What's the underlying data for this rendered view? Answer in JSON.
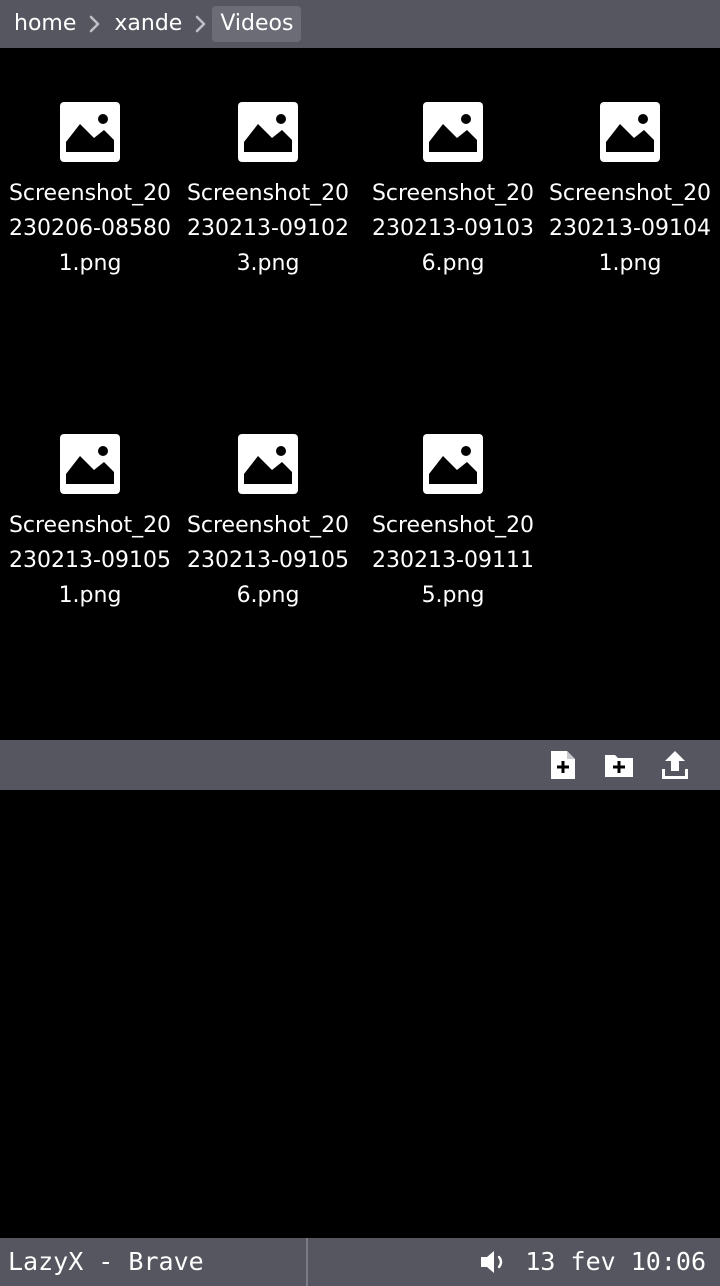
{
  "breadcrumb": {
    "items": [
      "home",
      "xande",
      "Videos"
    ]
  },
  "files": [
    {
      "name": "Screenshot_20230206-085801.png",
      "icon": "image-file-icon"
    },
    {
      "name": "Screenshot_20230213-091023.png",
      "icon": "image-file-icon"
    },
    {
      "name": "Screenshot_20230213-091036.png",
      "icon": "image-file-icon"
    },
    {
      "name": "Screenshot_20230213-091041.png",
      "icon": "image-file-icon"
    },
    {
      "name": "Screenshot_20230213-091051.png",
      "icon": "image-file-icon"
    },
    {
      "name": "Screenshot_20230213-091056.png",
      "icon": "image-file-icon"
    },
    {
      "name": "Screenshot_20230213-091115.png",
      "icon": "image-file-icon"
    }
  ],
  "actions": {
    "icons": [
      "new-file-icon",
      "new-folder-icon",
      "upload-icon"
    ]
  },
  "taskbar": {
    "title": "LazyX - Brave",
    "clock": "13 fev 10:06",
    "volume_icon": "volume-icon"
  },
  "colors": {
    "bar_bg": "#55565f",
    "active_crumb_bg": "#6b6c76",
    "background": "#000000"
  }
}
